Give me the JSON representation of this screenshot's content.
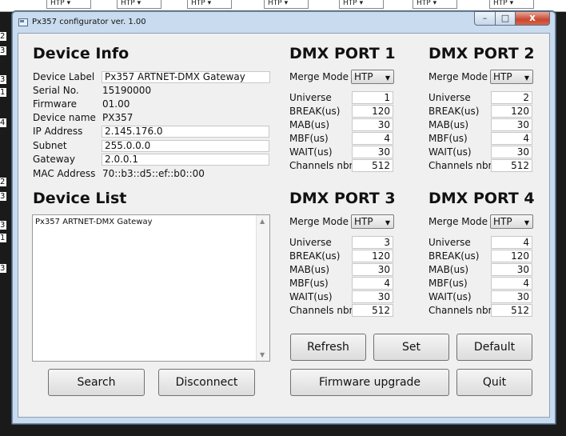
{
  "window": {
    "title": "Px357 configurator ver. 1.00",
    "minimize_glyph": "–",
    "maximize_glyph": "□",
    "close_glyph": "x"
  },
  "device_info": {
    "heading": "Device Info",
    "rows": [
      {
        "label": "Device Label",
        "value": "Px357 ARTNET-DMX Gateway",
        "editable": true
      },
      {
        "label": "Serial No.",
        "value": "15190000",
        "editable": false
      },
      {
        "label": "Firmware",
        "value": "01.00",
        "editable": false
      },
      {
        "label": "Device name",
        "value": "PX357",
        "editable": false
      },
      {
        "label": "IP Address",
        "value": "2.145.176.0",
        "editable": true
      },
      {
        "label": "Subnet",
        "value": "255.0.0.0",
        "editable": true
      },
      {
        "label": "Gateway",
        "value": "2.0.0.1",
        "editable": true
      },
      {
        "label": "MAC Address",
        "value": "70::b3::d5::ef::b0::00",
        "editable": false
      }
    ]
  },
  "device_list": {
    "heading": "Device List",
    "items": [
      "Px357 ARTNET-DMX Gateway"
    ]
  },
  "ports": [
    {
      "heading": "DMX PORT 1",
      "merge_label": "Merge Mode",
      "merge_value": "HTP",
      "params": [
        {
          "label": "Universe",
          "value": "1"
        },
        {
          "label": "BREAK(us)",
          "value": "120"
        },
        {
          "label": "MAB(us)",
          "value": "30"
        },
        {
          "label": "MBF(us)",
          "value": "4"
        },
        {
          "label": "WAIT(us)",
          "value": "30"
        },
        {
          "label": "Channels nbr",
          "value": "512"
        }
      ]
    },
    {
      "heading": "DMX PORT 2",
      "merge_label": "Merge Mode",
      "merge_value": "HTP",
      "params": [
        {
          "label": "Universe",
          "value": "2"
        },
        {
          "label": "BREAK(us)",
          "value": "120"
        },
        {
          "label": "MAB(us)",
          "value": "30"
        },
        {
          "label": "MBF(us)",
          "value": "4"
        },
        {
          "label": "WAIT(us)",
          "value": "30"
        },
        {
          "label": "Channels nbr",
          "value": "512"
        }
      ]
    },
    {
      "heading": "DMX PORT 3",
      "merge_label": "Merge Mode",
      "merge_value": "HTP",
      "params": [
        {
          "label": "Universe",
          "value": "3"
        },
        {
          "label": "BREAK(us)",
          "value": "120"
        },
        {
          "label": "MAB(us)",
          "value": "30"
        },
        {
          "label": "MBF(us)",
          "value": "4"
        },
        {
          "label": "WAIT(us)",
          "value": "30"
        },
        {
          "label": "Channels nbr",
          "value": "512"
        }
      ]
    },
    {
      "heading": "DMX PORT 4",
      "merge_label": "Merge Mode",
      "merge_value": "HTP",
      "params": [
        {
          "label": "Universe",
          "value": "4"
        },
        {
          "label": "BREAK(us)",
          "value": "120"
        },
        {
          "label": "MAB(us)",
          "value": "30"
        },
        {
          "label": "MBF(us)",
          "value": "4"
        },
        {
          "label": "WAIT(us)",
          "value": "30"
        },
        {
          "label": "Channels nbr",
          "value": "512"
        }
      ]
    }
  ],
  "buttons": {
    "search": "Search",
    "disconnect": "Disconnect",
    "refresh": "Refresh",
    "set": "Set",
    "default": "Default",
    "firmware_upgrade": "Firmware upgrade",
    "quit": "Quit"
  },
  "background": {
    "cell_text": "HTP",
    "line_numbers": [
      "2",
      "3",
      "3",
      "1",
      "4",
      "2",
      "3",
      "3",
      "1",
      "3"
    ]
  },
  "colors": {
    "window_frame": "#c9dbee",
    "close_button": "#c7482f",
    "client_bg": "#f0f0f0"
  }
}
